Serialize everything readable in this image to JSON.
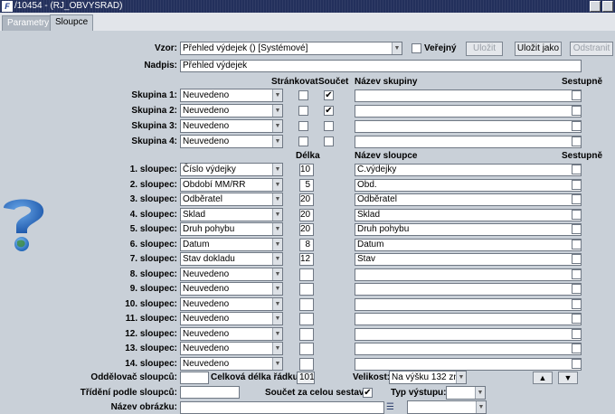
{
  "window": {
    "title": "/10454 - (RJ_OBVYSRAD)",
    "logo": "F"
  },
  "tabs": [
    {
      "label": "Parametry"
    },
    {
      "label": "Sloupce"
    }
  ],
  "form": {
    "vzor_label": "Vzor:",
    "vzor_value": "Přehled výdejek   ()   [Systémové]",
    "verejny_label": "Veřejný",
    "ulozit_label": "Uložit",
    "ulozit_jako_label": "Uložit jako",
    "odstranit_label": "Odstranit",
    "nadpis_label": "Nadpis:",
    "nadpis_value": "Přehled výdejek"
  },
  "group_headers": {
    "strankovat": "Stránkovat",
    "soucet": "Součet",
    "nazev_skupiny": "Název skupiny",
    "sestupne": "Sestupně"
  },
  "groups": [
    {
      "label": "Skupina 1:",
      "value": "Neuvedeno",
      "strankovat": false,
      "soucet": true,
      "name": "",
      "sestupne": false
    },
    {
      "label": "Skupina 2:",
      "value": "Neuvedeno",
      "strankovat": false,
      "soucet": true,
      "name": "",
      "sestupne": false
    },
    {
      "label": "Skupina 3:",
      "value": "Neuvedeno",
      "strankovat": false,
      "soucet": false,
      "name": "",
      "sestupne": false
    },
    {
      "label": "Skupina 4:",
      "value": "Neuvedeno",
      "strankovat": false,
      "soucet": false,
      "name": "",
      "sestupne": false
    }
  ],
  "column_headers": {
    "delka": "Délka",
    "nazev_sloupce": "Název sloupce",
    "sestupne": "Sestupně"
  },
  "columns": [
    {
      "label": "1. sloupec:",
      "value": "Číslo výdejky",
      "delka": "10",
      "name": "Č.výdejky",
      "sestupne": false
    },
    {
      "label": "2. sloupec:",
      "value": "Období MM/RR",
      "delka": "5",
      "name": "Obd.",
      "sestupne": false
    },
    {
      "label": "3. sloupec:",
      "value": "Odběratel",
      "delka": "20",
      "name": "Odběratel",
      "sestupne": false
    },
    {
      "label": "4. sloupec:",
      "value": "Sklad",
      "delka": "20",
      "name": "Sklad",
      "sestupne": false
    },
    {
      "label": "5. sloupec:",
      "value": "Druh pohybu",
      "delka": "20",
      "name": "Druh pohybu",
      "sestupne": false
    },
    {
      "label": "6. sloupec:",
      "value": "Datum",
      "delka": "8",
      "name": "Datum",
      "sestupne": false
    },
    {
      "label": "7. sloupec:",
      "value": "Stav dokladu",
      "delka": "12",
      "name": "Stav",
      "sestupne": false
    },
    {
      "label": "8. sloupec:",
      "value": "Neuvedeno",
      "delka": "",
      "name": "",
      "sestupne": false
    },
    {
      "label": "9. sloupec:",
      "value": "Neuvedeno",
      "delka": "",
      "name": "",
      "sestupne": false
    },
    {
      "label": "10. sloupec:",
      "value": "Neuvedeno",
      "delka": "",
      "name": "",
      "sestupne": false
    },
    {
      "label": "11. sloupec:",
      "value": "Neuvedeno",
      "delka": "",
      "name": "",
      "sestupne": false
    },
    {
      "label": "12. sloupec:",
      "value": "Neuvedeno",
      "delka": "",
      "name": "",
      "sestupne": false
    },
    {
      "label": "13. sloupec:",
      "value": "Neuvedeno",
      "delka": "",
      "name": "",
      "sestupne": false
    },
    {
      "label": "14. sloupec:",
      "value": "Neuvedeno",
      "delka": "",
      "name": "",
      "sestupne": false
    }
  ],
  "footer": {
    "oddelovac_label": "Oddělovač sloupců:",
    "oddelovac_value": "",
    "celkova_delka_label": "Celková délka řádku:",
    "celkova_delka_value": "101",
    "velikost_label": "Velikost:",
    "velikost_value": "Na výšku 132 zn.",
    "trideni_label": "Třídění podle sloupců:",
    "trideni_value": "",
    "soucet_sestavu_label": "Součet za celou sestavu:",
    "soucet_sestavu_checked": true,
    "typ_vystupu_label": "Typ výstupu:",
    "typ_vystupu_value": "",
    "nazev_obrazku_label": "Název obrázku:",
    "nazev_obrazku_value": "",
    "extra_select_value": ""
  },
  "icons": {
    "help": "help-question-globe-icon",
    "list": "list-picker-icon",
    "up": "arrow-up-icon",
    "down": "arrow-down-icon"
  }
}
